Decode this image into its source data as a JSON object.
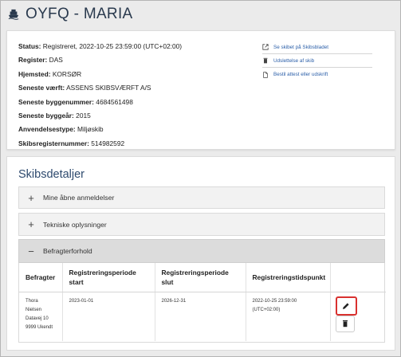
{
  "page": {
    "title": "OYFQ - MARIA"
  },
  "ship_info": {
    "rows": [
      {
        "label": "Status:",
        "value": "Registreret, 2022-10-25 23:59:00 (UTC+02:00)"
      },
      {
        "label": "Register:",
        "value": "DAS"
      },
      {
        "label": "Hjemsted:",
        "value": "KORSØR"
      },
      {
        "label": "Seneste værft:",
        "value": "ASSENS SKIBSVÆRFT A/S"
      },
      {
        "label": "Seneste byggenummer:",
        "value": "4684561498"
      },
      {
        "label": "Seneste byggeår:",
        "value": "2015"
      },
      {
        "label": "Anvendelsestype:",
        "value": "Miljøskib"
      },
      {
        "label": "Skibsregisternummer:",
        "value": "514982592"
      }
    ]
  },
  "actions": [
    {
      "label": "Se skibet på Skibsbladet",
      "icon": "external-link-icon"
    },
    {
      "label": "Udslettelse af skib",
      "icon": "trash-icon"
    },
    {
      "label": "Bestil attest eller udskrift",
      "icon": "document-icon"
    }
  ],
  "details": {
    "title": "Skibsdetaljer",
    "sections": [
      {
        "symbol": "+",
        "label": "Mine åbne anmeldelser"
      },
      {
        "symbol": "+",
        "label": "Tekniske oplysninger"
      },
      {
        "symbol": "−",
        "label": "Befragterforhold"
      }
    ],
    "table": {
      "headers": [
        "Befragter",
        "Registreringsperiode start",
        "Registreringsperiode slut",
        "Registreringstidspunkt",
        ""
      ],
      "row": {
        "befragter_lines": [
          "Thora",
          "Nielsen",
          "Datavej 10",
          "9999 Ukendt"
        ],
        "start": "2023-01-01",
        "slut": "2026-12-31",
        "tidspunkt_line1": "2022-10-25 23:59:00",
        "tidspunkt_line2": "(UTC+02:00)"
      }
    }
  }
}
